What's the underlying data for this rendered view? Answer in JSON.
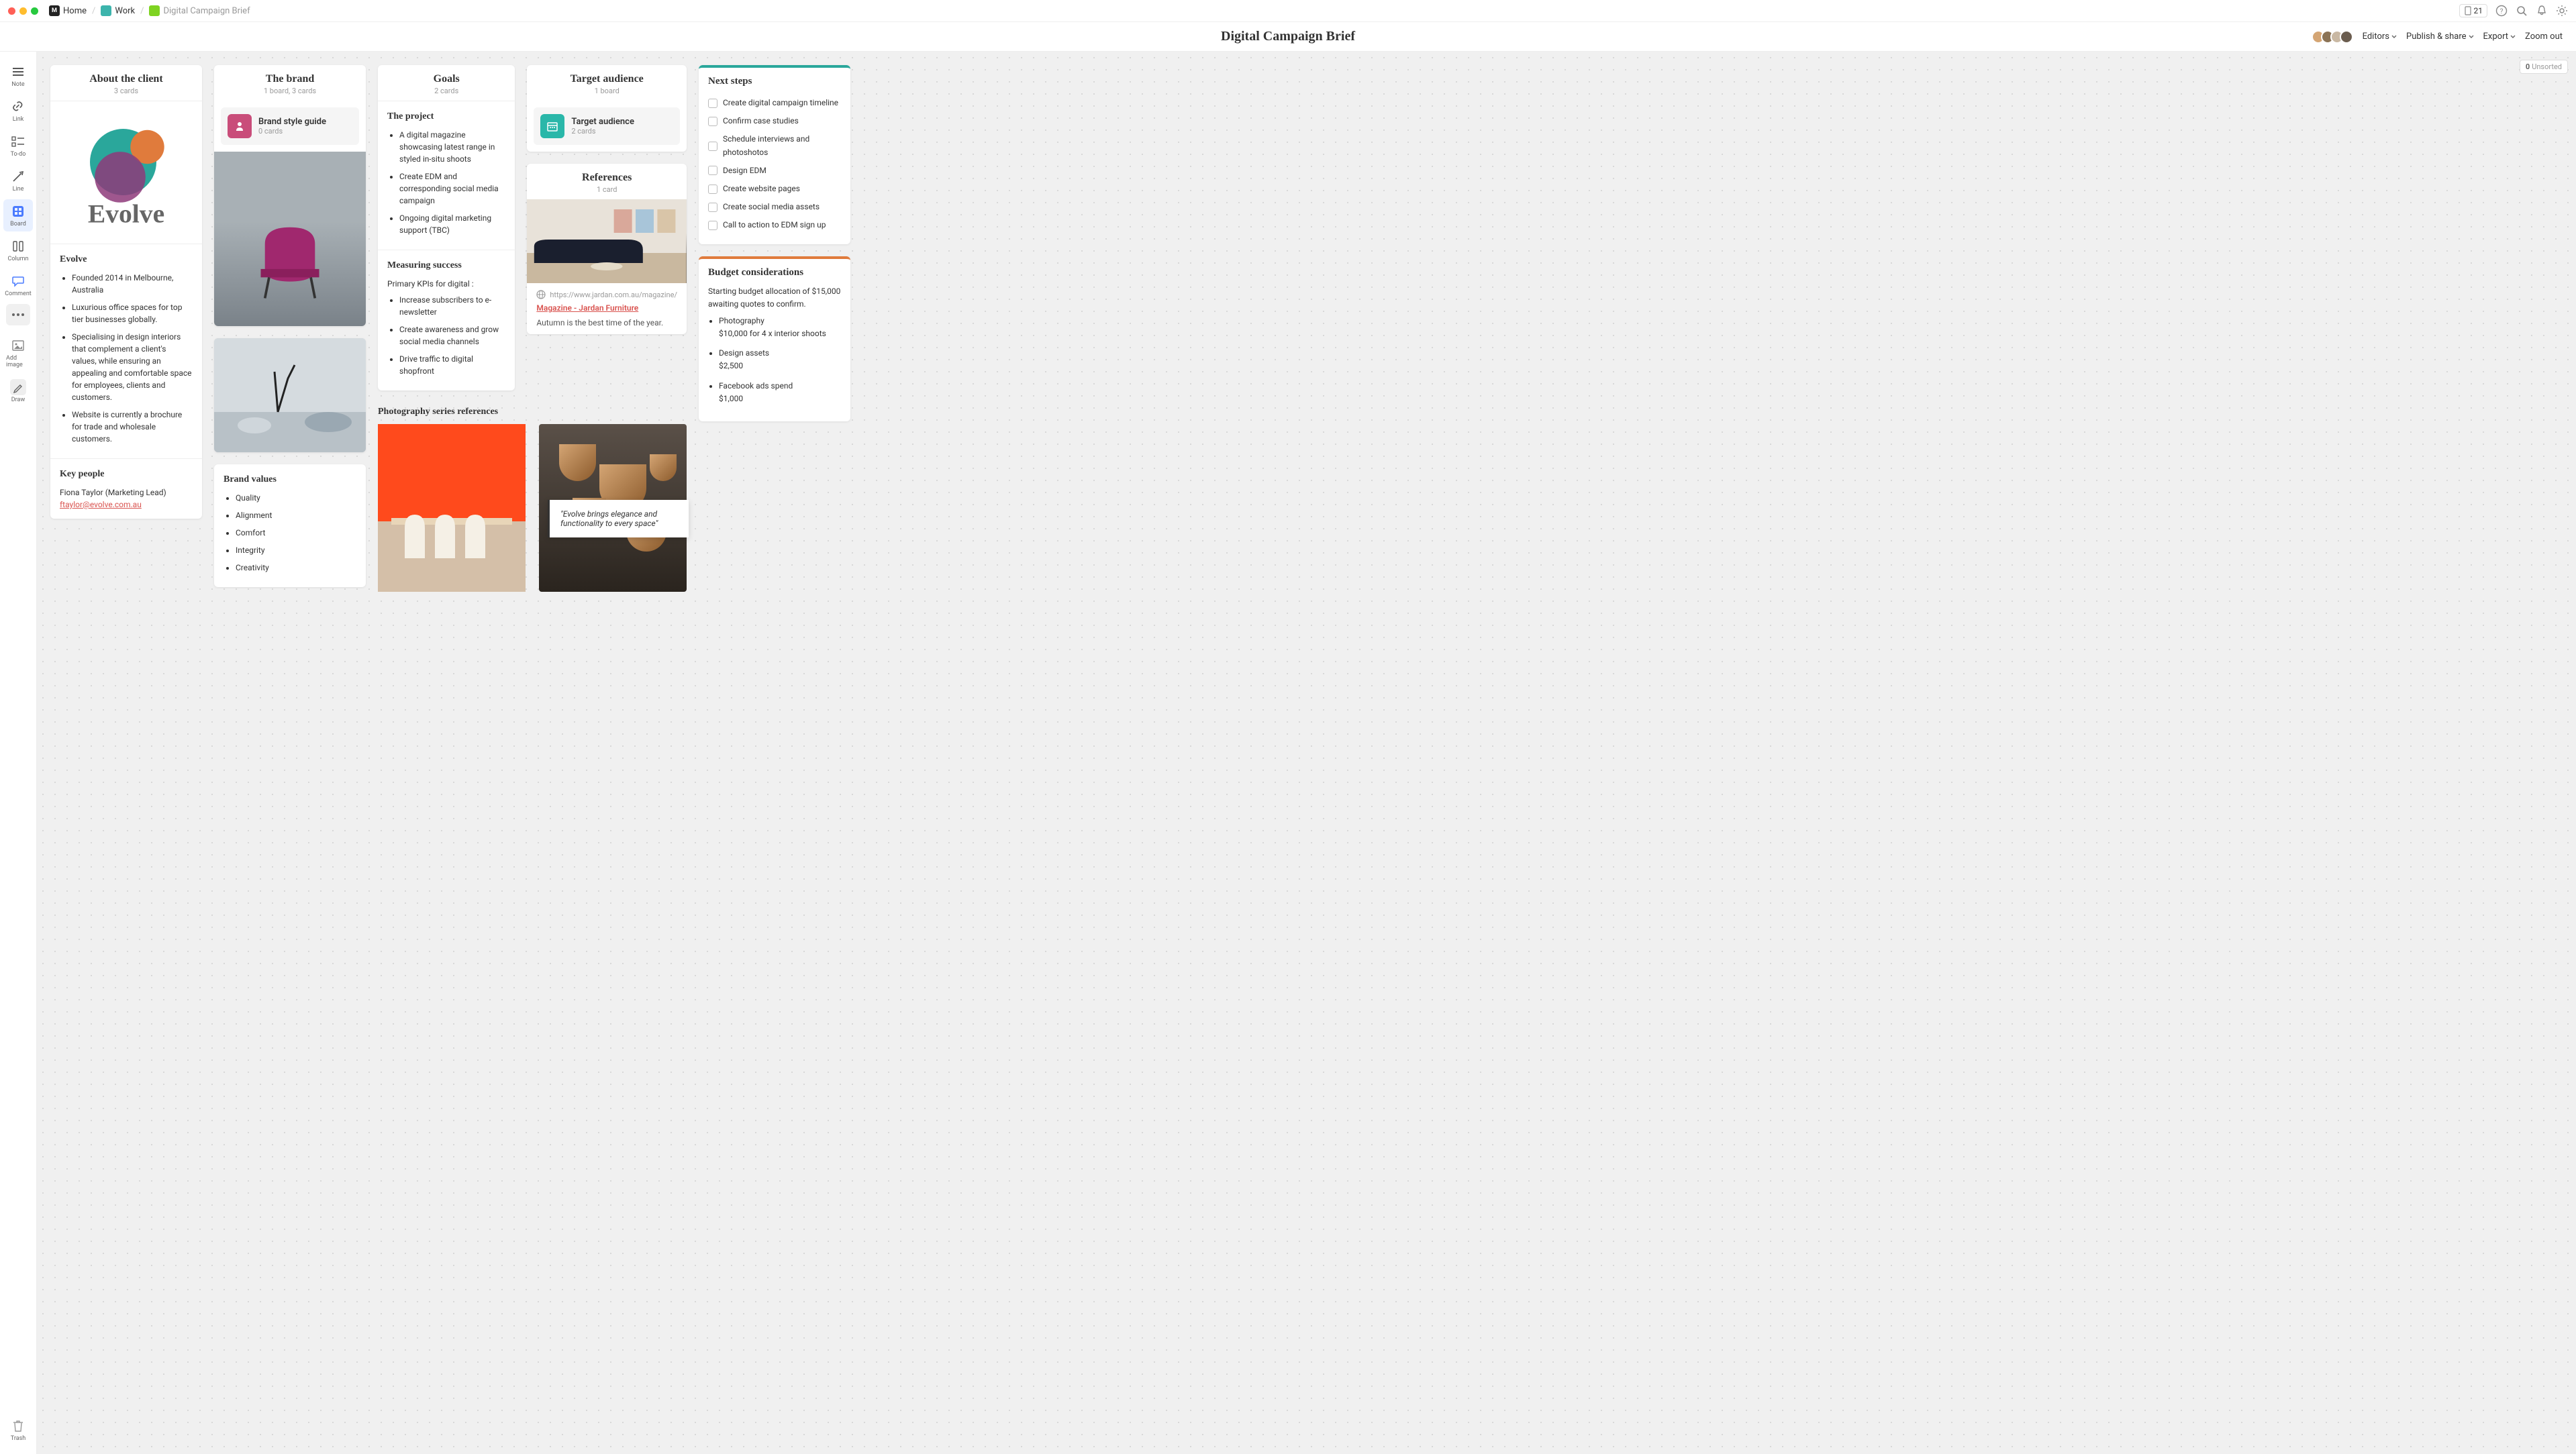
{
  "breadcrumb": {
    "home": "Home",
    "work": "Work",
    "page": "Digital Campaign Brief"
  },
  "chrome": {
    "device_count": "21"
  },
  "header": {
    "title": "Digital Campaign Brief",
    "editors": "Editors",
    "publish": "Publish & share",
    "export": "Export",
    "zoom_out": "Zoom out"
  },
  "sidebar_tools": {
    "note": "Note",
    "link": "Link",
    "todo": "To-do",
    "line": "Line",
    "board": "Board",
    "column": "Column",
    "comment": "Comment",
    "add_image": "Add image",
    "draw": "Draw",
    "trash": "Trash"
  },
  "unsorted": {
    "count": "0",
    "label": "Unsorted"
  },
  "about_client": {
    "title": "About the client",
    "sub": "3 cards",
    "logo_name": "Evolve",
    "heading": "Evolve",
    "bullets": [
      "Founded 2014 in Melbourne, Australia",
      "Luxurious office spaces for top tier businesses globally.",
      "Specialising in design interiors that complement a client's values, while ensuring an appealing and comfortable space for employees, clients and customers.",
      "Website is currently a brochure for trade and wholesale customers."
    ],
    "key_people_heading": "Key people",
    "contact_name": "Fiona Taylor (Marketing Lead)",
    "contact_email": "ftaylor@evolve.com.au"
  },
  "brand": {
    "title": "The brand",
    "sub": "1 board, 3 cards",
    "style_guide": {
      "title": "Brand style guide",
      "sub": "0 cards"
    },
    "values_heading": "Brand values",
    "values": [
      "Quality",
      "Alignment",
      "Comfort",
      "Integrity",
      "Creativity"
    ]
  },
  "goals": {
    "title": "Goals",
    "sub": "2 cards",
    "project_heading": "The project",
    "project_bullets": [
      "A digital magazine showcasing latest range in styled in-situ shoots",
      "Create EDM and corresponding social media campaign",
      "Ongoing digital marketing support (TBC)"
    ],
    "success_heading": "Measuring success",
    "kpi_intro": "Primary KPIs for digital :",
    "kpi_bullets": [
      "Increase subscribers to e-newsletter",
      "Create awareness and grow social media channels",
      "Drive traffic to digital shopfront"
    ]
  },
  "target": {
    "title": "Target audience",
    "sub": "1 board",
    "board": {
      "title": "Target audience",
      "sub": "2 cards"
    }
  },
  "references": {
    "title": "References",
    "sub": "1 card",
    "url": "https://www.jardan.com.au/magazine/",
    "link_label": "Magazine - Jardan Furniture",
    "caption": "Autumn is the best time of the year."
  },
  "photo_series": {
    "title": "Photography series references",
    "quote": "\"Evolve brings elegance and functionality to every space\""
  },
  "next_steps": {
    "title": "Next steps",
    "items": [
      "Create digital campaign timeline",
      "Confirm case studies",
      "Schedule interviews and photoshotos",
      "Design EDM",
      "Create website pages",
      "Create social media assets",
      "Call to action to EDM sign up"
    ]
  },
  "budget": {
    "title": "Budget considerations",
    "intro": "Starting budget allocation of $15,000 awaiting  quotes to confirm.",
    "items": [
      {
        "label": "Photography",
        "detail": "$10,000 for 4 x interior shoots"
      },
      {
        "label": "Design assets",
        "detail": "$2,500"
      },
      {
        "label": "Facebook ads spend",
        "detail": "$1,000"
      }
    ]
  }
}
